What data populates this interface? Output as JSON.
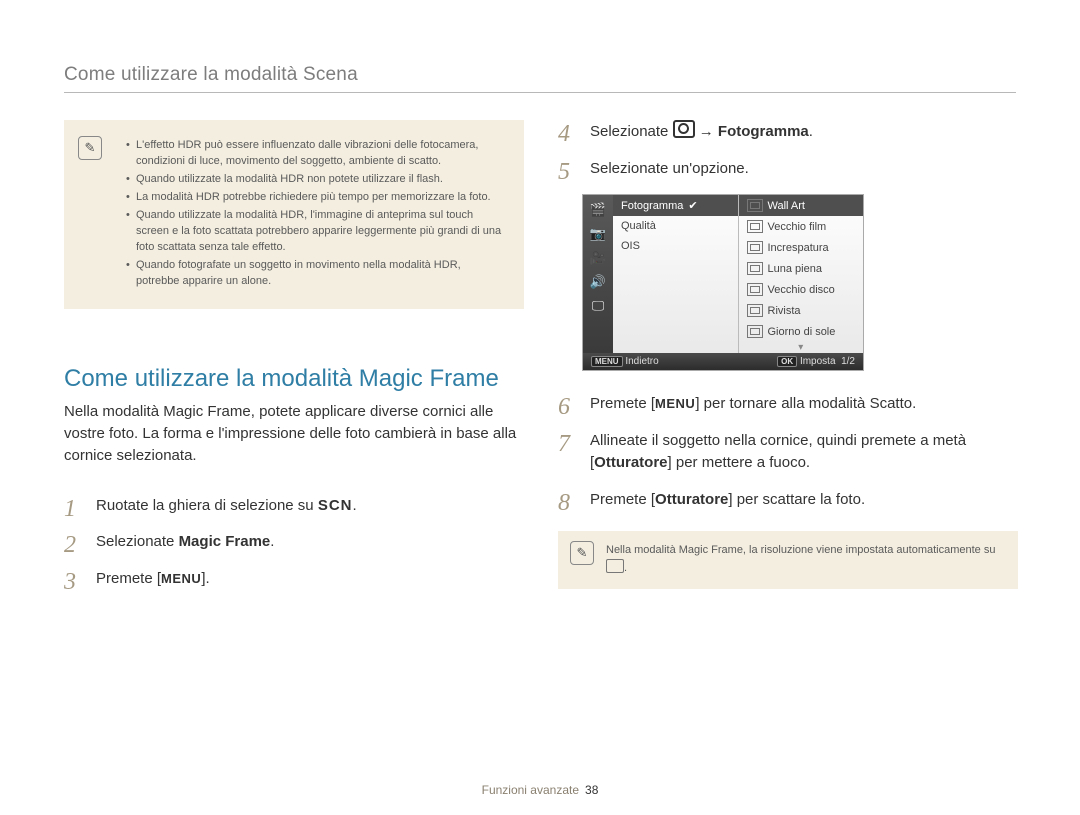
{
  "header": {
    "title": "Come utilizzare la modalità Scena"
  },
  "note_left": {
    "items": [
      "L'effetto HDR può essere influenzato dalle vibrazioni delle fotocamera, condizioni di luce, movimento del soggetto, ambiente di scatto.",
      "Quando utilizzate la modalità HDR non potete utilizzare il flash.",
      "La modalità HDR potrebbe richiedere più tempo per memorizzare la foto.",
      "Quando utilizzate la modalità HDR, l'immagine di anteprima sul touch screen e la foto scattata potrebbero apparire leggermente più grandi di una foto scattata senza tale effetto.",
      "Quando fotografate un soggetto in movimento nella modalità HDR, potrebbe apparire un alone."
    ]
  },
  "section": {
    "title": "Come utilizzare la modalità Magic Frame",
    "intro": "Nella modalità Magic Frame, potete applicare diverse cornici alle vostre foto. La forma e l'impressione delle foto cambierà in base alla cornice selezionata."
  },
  "steps_left": {
    "n1": "1",
    "s1_a": "Ruotate la ghiera di selezione su ",
    "s1_b": "SCN",
    "s1_c": ".",
    "n2": "2",
    "s2_a": "Selezionate ",
    "s2_b": "Magic Frame",
    "s2_c": ".",
    "n3": "3",
    "s3_a": "Premete [",
    "s3_b": "MENU",
    "s3_c": "]."
  },
  "steps_right": {
    "n4": "4",
    "s4_a": "Selezionate ",
    "s4_arrow": " → ",
    "s4_b": "Fotogramma",
    "s4_c": ".",
    "n5": "5",
    "s5": "Selezionate un'opzione.",
    "n6": "6",
    "s6_a": "Premete [",
    "s6_b": "MENU",
    "s6_c": "] per tornare alla modalità Scatto.",
    "n7": "7",
    "s7_a": "Allineate il soggetto nella cornice, quindi premete a metà [",
    "s7_b": "Otturatore",
    "s7_c": "] per mettere a fuoco.",
    "n8": "8",
    "s8_a": "Premete [",
    "s8_b": "Otturatore",
    "s8_c": "] per scattare la foto."
  },
  "lcd": {
    "left": {
      "r1": "Fotogramma",
      "r2": "Qualità",
      "r3": "OIS"
    },
    "right": {
      "r1": "Wall Art",
      "r2": "Vecchio film",
      "r3": "Increspatura",
      "r4": "Luna piena",
      "r5": "Vecchio disco",
      "r6": "Rivista",
      "r7": "Giorno di sole"
    },
    "foot": {
      "back_tag": "MENU",
      "back": "Indietro",
      "set_tag": "OK",
      "set": "Imposta",
      "page": "1/2"
    }
  },
  "note_right": {
    "t1": "Nella modalità Magic Frame, la risoluzione viene impostata automaticamente su ",
    "t2": "."
  },
  "footer": {
    "section": "Funzioni avanzate",
    "page": "38"
  }
}
